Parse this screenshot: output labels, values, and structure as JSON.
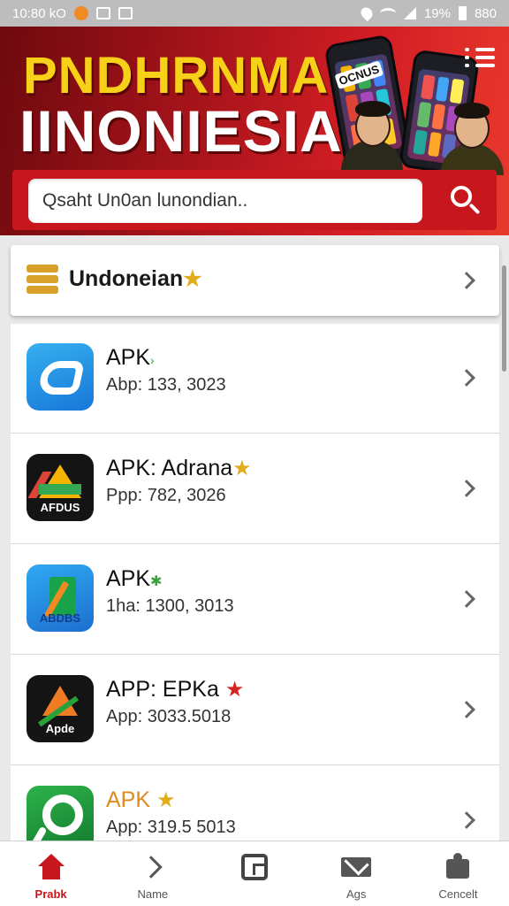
{
  "status_bar": {
    "time": "10:80 kO",
    "battery": "19%",
    "extra": "880"
  },
  "header": {
    "title_line1": "PNDHRNMA",
    "title_line2": "IINONIESIA",
    "phone_label": "OCNUS"
  },
  "search": {
    "placeholder": "Qsaht Un0an lunondian.."
  },
  "category": {
    "title": "Undoneian"
  },
  "apps": [
    {
      "name": "APK",
      "subtitle": "Abp: 133, 3023",
      "icon": "blue-app-icon"
    },
    {
      "name": "APK: Adrana",
      "subtitle": "Ppp: 782, 3026",
      "icon": "drive-app-icon",
      "icon_caption": "AFDUS"
    },
    {
      "name": "APK",
      "subtitle": "1ha: 1300, 3013",
      "icon": "orange-app-icon",
      "icon_caption": "ABDBS"
    },
    {
      "name": "APP: EPKa",
      "subtitle": "App: 3033.5018",
      "icon": "red-app-icon",
      "icon_caption": "Apde"
    },
    {
      "name": "APK",
      "subtitle": "App: 319.5 5013",
      "icon": "green-app-icon"
    }
  ],
  "bottom_nav": [
    {
      "label": "Prabk",
      "icon": "home-icon",
      "active": true
    },
    {
      "label": "Name",
      "icon": "chevron-right-icon",
      "active": false
    },
    {
      "label": "",
      "icon": "square-icon",
      "active": false
    },
    {
      "label": "Ags",
      "icon": "mail-icon",
      "active": false
    },
    {
      "label": "Cencelt",
      "icon": "puzzle-icon",
      "active": false
    }
  ],
  "colors": {
    "brand_red": "#c8161d",
    "brand_yellow": "#f7d117",
    "star_gold": "#e2ad1c"
  }
}
